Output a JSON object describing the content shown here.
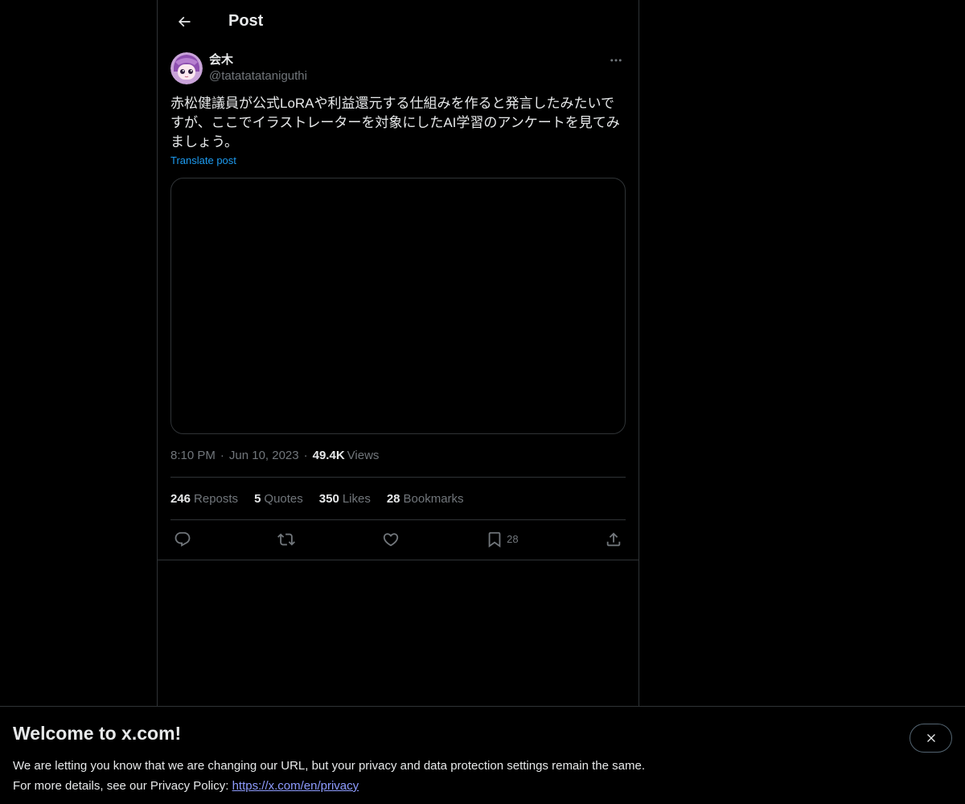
{
  "header": {
    "title": "Post"
  },
  "post": {
    "author": {
      "display_name": "会木",
      "handle": "@tatatatataniguthi"
    },
    "text": "赤松健議員が公式LoRAや利益還元する仕組みを作ると発言したみたいですが、ここでイラストレーターを対象にしたAI学習のアンケートを見てみましょう。",
    "translate_label": "Translate post",
    "time": "8:10 PM",
    "date": "Jun 10, 2023",
    "views_count": "49.4K",
    "views_label": "Views",
    "stats": {
      "reposts_count": "246",
      "reposts_label": "Reposts",
      "quotes_count": "5",
      "quotes_label": "Quotes",
      "likes_count": "350",
      "likes_label": "Likes",
      "bookmarks_count": "28",
      "bookmarks_label": "Bookmarks"
    },
    "actions": {
      "bookmark_count": "28"
    }
  },
  "banner": {
    "title": "Welcome to x.com!",
    "line1": "We are letting you know that we are changing our URL, but your privacy and data protection settings remain the same.",
    "line2_prefix": "For more details, see our Privacy Policy: ",
    "link": "https://x.com/en/privacy"
  },
  "colors": {
    "background": "#000000",
    "text": "#e7e9ea",
    "muted": "#71767b",
    "link": "#1d9bf0",
    "border": "#2f3336"
  }
}
